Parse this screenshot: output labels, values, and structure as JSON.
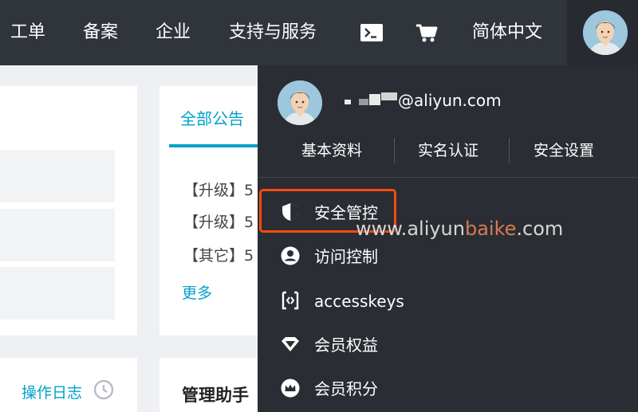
{
  "nav": {
    "items": [
      {
        "label": "工单"
      },
      {
        "label": "备案"
      },
      {
        "label": "企业"
      },
      {
        "label": "支持与服务"
      }
    ],
    "terminal_icon": "terminal-icon",
    "cart_icon": "cart-icon",
    "language": "简体中文",
    "avatar_icon": "user-avatar"
  },
  "notices": {
    "tab_label": "全部公告",
    "items": [
      "【升级】5",
      "【升级】5",
      "【其它】5"
    ],
    "more_label": "更多"
  },
  "oplog": {
    "label": "操作日志",
    "icon": "clock-icon"
  },
  "assistant": {
    "title": "管理助手"
  },
  "dropdown": {
    "email_suffix": "@aliyun.com",
    "links": [
      "基本资料",
      "实名认证",
      "安全设置"
    ],
    "menu": [
      {
        "label": "安全管控",
        "icon": "shield-icon"
      },
      {
        "label": "访问控制",
        "icon": "person-icon"
      },
      {
        "label": "accesskeys",
        "icon": "code-bracket-icon"
      },
      {
        "label": "会员权益",
        "icon": "diamond-icon"
      },
      {
        "label": "会员积分",
        "icon": "crown-icon"
      }
    ]
  },
  "watermark": {
    "prefix": "www.aliyun",
    "accent": "baike",
    "suffix": ".com"
  },
  "colors": {
    "nav_bg": "#30343b",
    "dropdown_bg": "#2a2d33",
    "accent": "#00a2ca",
    "highlight": "#ff4a10"
  }
}
